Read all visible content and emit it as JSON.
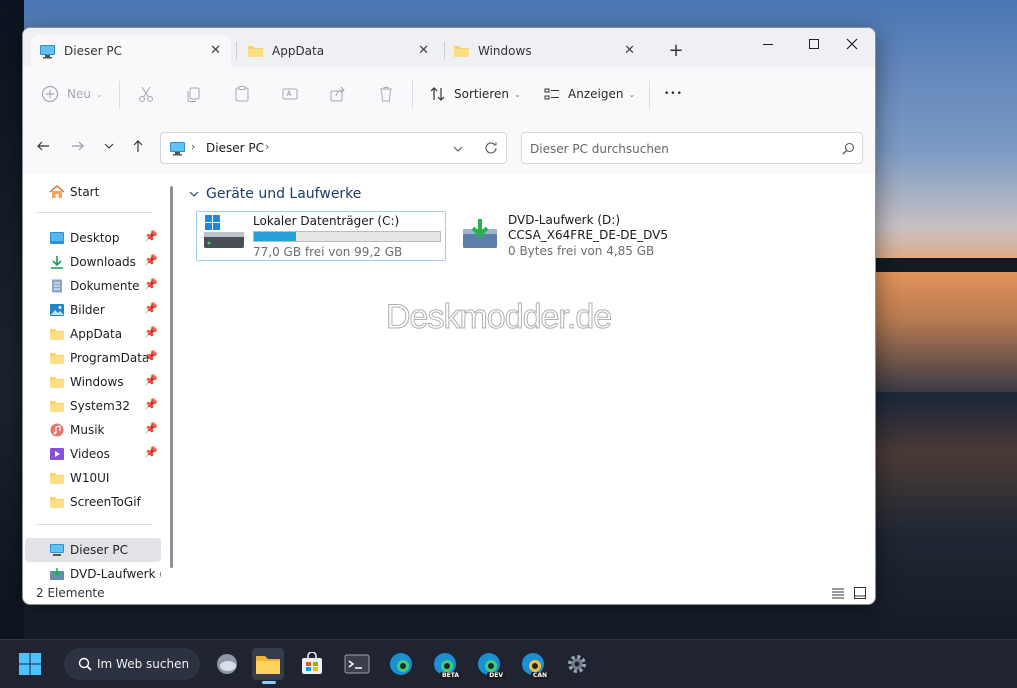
{
  "window": {
    "tabs": [
      {
        "label": "Dieser PC",
        "icon": "monitor-icon"
      },
      {
        "label": "AppData",
        "icon": "folder-icon"
      },
      {
        "label": "Windows",
        "icon": "folder-icon"
      }
    ],
    "close_glyph": "✕",
    "new_tab_glyph": "+"
  },
  "toolbar": {
    "new_label": "Neu",
    "sort_label": "Sortieren",
    "view_label": "Anzeigen",
    "more_glyph": "•••"
  },
  "address": {
    "location": "Dieser PC",
    "search_placeholder": "Dieser PC durchsuchen"
  },
  "sidebar": {
    "home": "Start",
    "items": [
      {
        "label": "Desktop",
        "icon": "desktop-icon",
        "pinned": true
      },
      {
        "label": "Downloads",
        "icon": "download-icon",
        "pinned": true
      },
      {
        "label": "Dokumente",
        "icon": "document-icon",
        "pinned": true
      },
      {
        "label": "Bilder",
        "icon": "pictures-icon",
        "pinned": true
      },
      {
        "label": "AppData",
        "icon": "folder-icon",
        "pinned": true
      },
      {
        "label": "ProgramData",
        "icon": "folder-icon",
        "pinned": true
      },
      {
        "label": "Windows",
        "icon": "folder-icon",
        "pinned": true
      },
      {
        "label": "System32",
        "icon": "folder-icon",
        "pinned": true
      },
      {
        "label": "Musik",
        "icon": "music-icon",
        "pinned": true
      },
      {
        "label": "Videos",
        "icon": "video-icon",
        "pinned": true
      },
      {
        "label": "W10UI",
        "icon": "folder-icon",
        "pinned": false
      },
      {
        "label": "ScreenToGif",
        "icon": "folder-icon",
        "pinned": false
      }
    ],
    "this_pc": "Dieser PC",
    "dvd": "DVD-Laufwerk (D:"
  },
  "content": {
    "group_title": "Geräte und Laufwerke",
    "drives": [
      {
        "name": "Lokaler Datenträger (C:)",
        "free_text": "77,0 GB frei von 99,2 GB",
        "used_fraction": 0.224
      },
      {
        "name": "DVD-Laufwerk (D:)",
        "label": "CCSA_X64FRE_DE-DE_DV5",
        "free_text": "0 Bytes frei von 4,85 GB"
      }
    ],
    "watermark": "Deskmodder.de"
  },
  "status": {
    "item_count": "2 Elemente"
  },
  "taskbar": {
    "search_label": "Im Web suchen",
    "badges": [
      "BETA",
      "DEV",
      "CAN"
    ]
  },
  "colors": {
    "accent": "#26a0da",
    "folder": "#f8d26a",
    "header_blue": "#1d3b6e"
  }
}
